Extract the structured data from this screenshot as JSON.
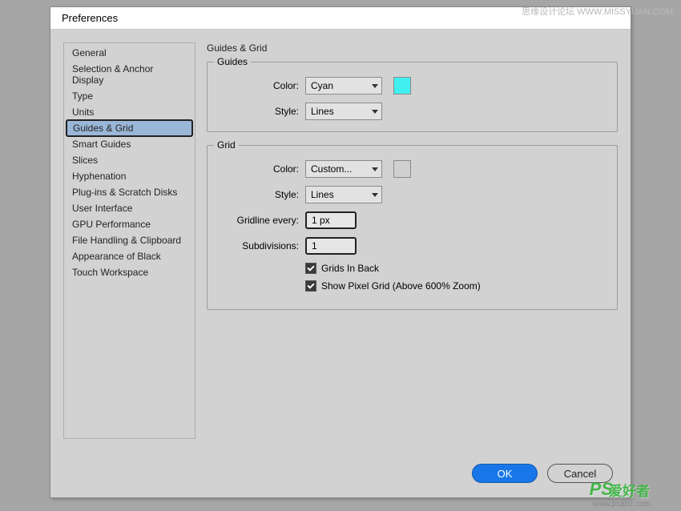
{
  "dialog": {
    "title": "Preferences"
  },
  "sidebar": {
    "items": [
      {
        "label": "General"
      },
      {
        "label": "Selection & Anchor Display"
      },
      {
        "label": "Type"
      },
      {
        "label": "Units"
      },
      {
        "label": "Guides & Grid",
        "selected": true
      },
      {
        "label": "Smart Guides"
      },
      {
        "label": "Slices"
      },
      {
        "label": "Hyphenation"
      },
      {
        "label": "Plug-ins & Scratch Disks"
      },
      {
        "label": "User Interface"
      },
      {
        "label": "GPU Performance"
      },
      {
        "label": "File Handling & Clipboard"
      },
      {
        "label": "Appearance of Black"
      },
      {
        "label": "Touch Workspace"
      }
    ]
  },
  "main": {
    "heading": "Guides & Grid",
    "guides": {
      "legend": "Guides",
      "color_label": "Color:",
      "color_value": "Cyan",
      "color_hex": "#40f0f0",
      "style_label": "Style:",
      "style_value": "Lines"
    },
    "grid": {
      "legend": "Grid",
      "color_label": "Color:",
      "color_value": "Custom...",
      "color_hex": "#d0d0d0",
      "style_label": "Style:",
      "style_value": "Lines",
      "gridline_label": "Gridline every:",
      "gridline_value": "1 px",
      "subdivisions_label": "Subdivisions:",
      "subdivisions_value": "1",
      "grids_in_back_label": "Grids In Back",
      "grids_in_back_checked": true,
      "show_pixel_grid_label": "Show Pixel Grid (Above 600% Zoom)",
      "show_pixel_grid_checked": true
    }
  },
  "buttons": {
    "ok": "OK",
    "cancel": "Cancel"
  },
  "watermarks": {
    "top": "思缘设计论坛  WWW.MISSYUAN.COM",
    "ps": "PS",
    "cn": "爱好者",
    "url": "www.psahz.com"
  }
}
